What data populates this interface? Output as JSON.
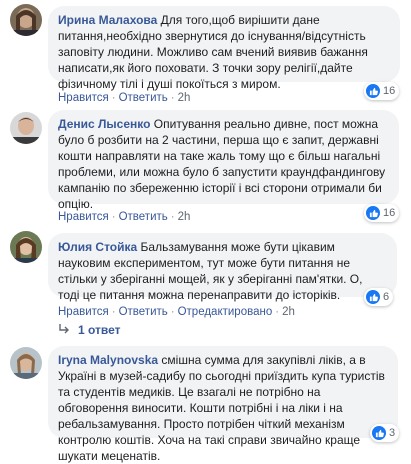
{
  "comments": [
    {
      "author": "Ирина Малахова",
      "text": "Для того,щоб вирішити дане питання,необхідно звернутися до існування/відсутність заповіту людини. Можливо сам вчений виявив бажання написати,як його поховати. З точки зору релігії,дайте фізичному тілі і душі покоїться з миром.",
      "like_label": "Нравится",
      "reply_label": "Ответить",
      "time": "2h",
      "reactions": "16"
    },
    {
      "author": "Денис Лысенко",
      "text": "Опитування реально дивне, пост можна було б розбити на 2 частини, перша що є запит, державні кошти направляти на таке жаль тому що є більш нагальні проблеми, или можна було б запустити краундфандингову кампанію по збереженню історії і всі сторони отримали би опцію.",
      "like_label": "Нравится",
      "reply_label": "Ответить",
      "time": "2h",
      "reactions": "16"
    },
    {
      "author": "Юлия Стойка",
      "text": "Бальзамування може бути цікавим науковим експериментом, тут може бути питання не стільки у зберіганні мощей, як у зберіганні пам'ятки. О, тоді це питання можна перенаправити до історіків.",
      "like_label": "Нравится",
      "reply_label": "Ответить",
      "edited_label": "Отредактировано",
      "time": "2h",
      "reactions": "6",
      "replies_label": "1 ответ"
    },
    {
      "author": "Iryna Malynovska",
      "text": "смішна сумма для закупівлі ліків, а в Україні в музей-садибу по сьогодні приїздить купа туристів та студентів медиків. Це взагалі не потрібно на обговорення виносити. Кошти потрібні і на ліки і на ребальзамування. Просто потрібен чіткий механізм контролю коштів. Хоча на такі справи звичайно краще шукати меценатів.",
      "reactions": "3"
    }
  ],
  "colors": {
    "author": "#385898",
    "bubble": "#f2f3f5",
    "like": "#1877f2"
  }
}
